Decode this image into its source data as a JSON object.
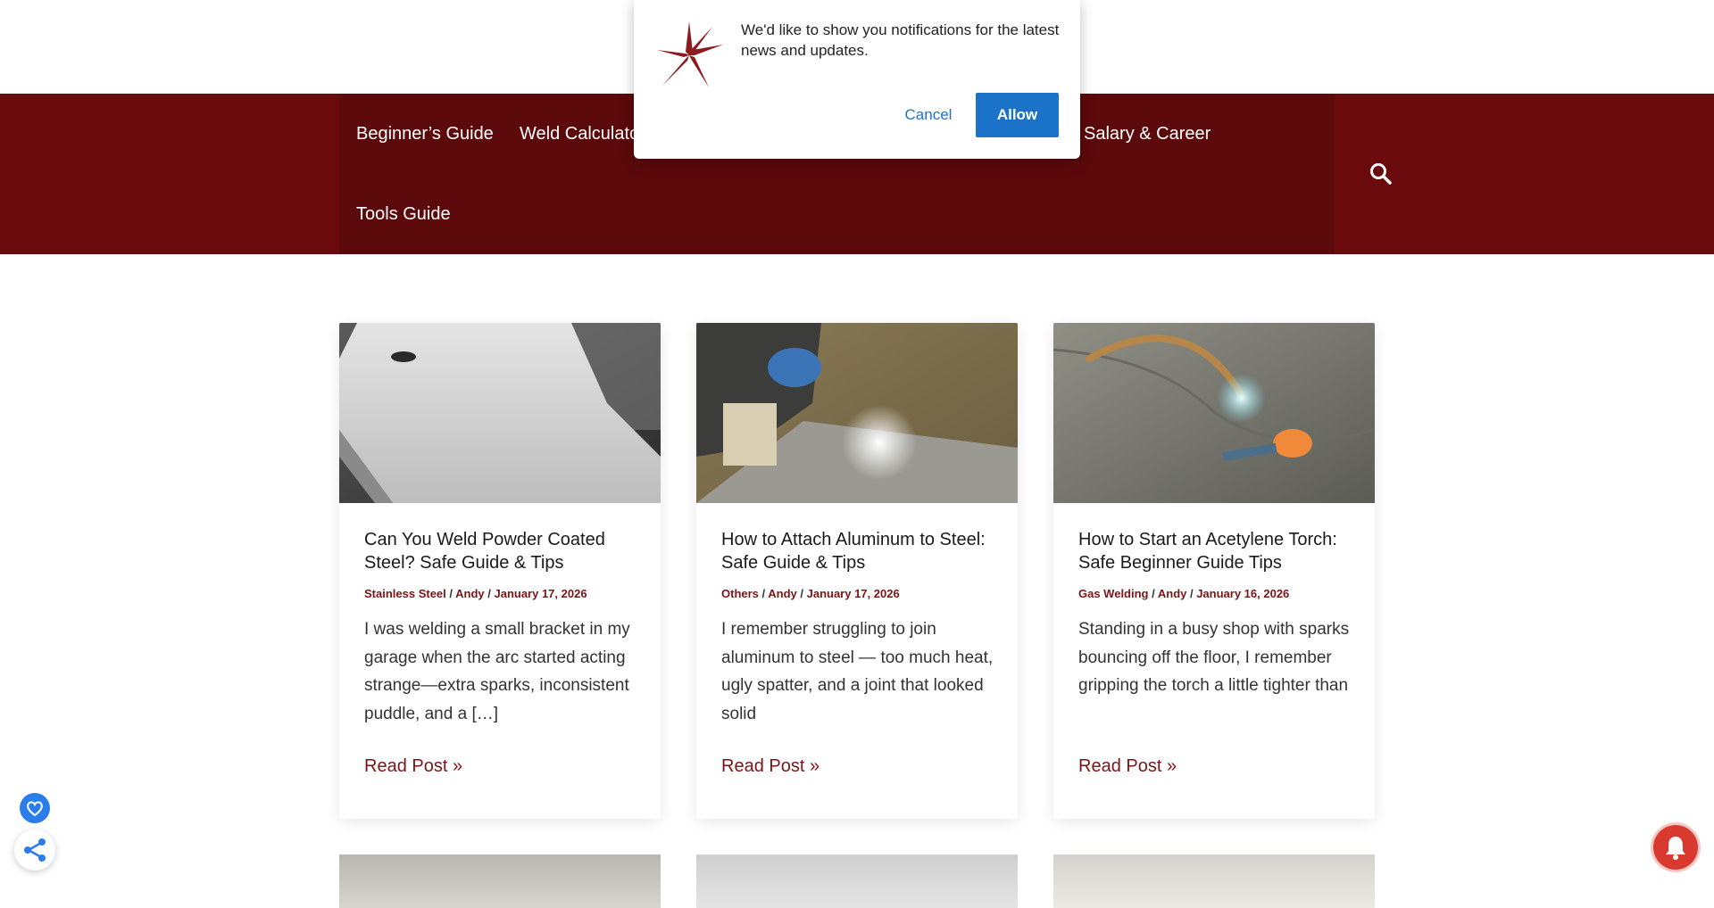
{
  "nav": {
    "items": [
      {
        "label": "Beginner’s Guide"
      },
      {
        "label": "Weld Calculator"
      },
      {
        "label": "Salary & Career"
      },
      {
        "label": "Tools Guide"
      }
    ],
    "search_icon": "search-icon",
    "bar_color": "#6b0a0d"
  },
  "notification": {
    "message": "We'd like to show you notifications for the latest news and updates.",
    "cancel_label": "Cancel",
    "allow_label": "Allow",
    "accent_color": "#1a73c8"
  },
  "posts": [
    {
      "title": "Can You Weld Powder Coated Steel? Safe Guide & Tips",
      "category": "Stainless Steel",
      "author": "Andy",
      "date": "January 17, 2026",
      "excerpt": "I was welding a small bracket in my garage when the arc started acting strange—extra sparks, inconsistent puddle, and a […]",
      "read_more": "Read Post »"
    },
    {
      "title": "How to Attach Aluminum to Steel: Safe Guide & Tips",
      "category": "Others",
      "author": "Andy",
      "date": "January 17, 2026",
      "excerpt": "I remember struggling to join aluminum to steel — too much heat, ugly spatter, and a joint that looked solid",
      "read_more": "Read Post »"
    },
    {
      "title": "How to Start an Acetylene Torch: Safe Beginner Guide Tips",
      "category": "Gas Welding",
      "author": "Andy",
      "date": "January 16, 2026",
      "excerpt": "Standing in a busy shop with sparks bouncing off the floor, I remember gripping the torch a little tighter than",
      "read_more": "Read Post »"
    }
  ],
  "meta_separator": " / ",
  "widgets": {
    "heart_icon": "heart-icon",
    "share_icon": "share-icon",
    "bell_icon": "bell-icon"
  }
}
